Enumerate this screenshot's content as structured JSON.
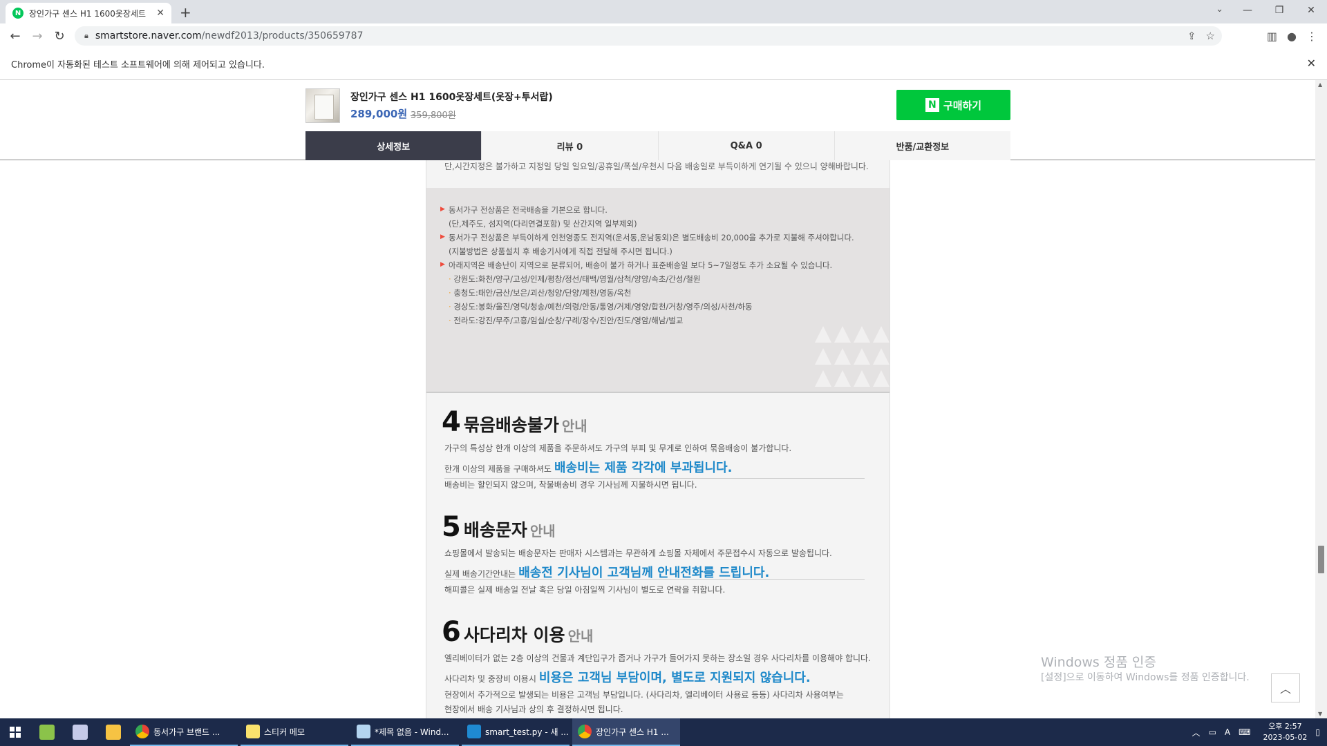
{
  "browser": {
    "tab_title": "장인가구 센스 H1 1600옷장세트",
    "url_host": "smartstore.naver.com",
    "url_path": "/newdf2013/products/350659787",
    "infobar_text": "Chrome이 자동화된 테스트 소프트웨어에 의해 제어되고 있습니다."
  },
  "product": {
    "name": "장인가구 센스 H1 1600옷장세트(옷장+투서랍)",
    "price": "289,000원",
    "original_price": "359,800원",
    "buy_label": "구매하기",
    "buy_logo": "N"
  },
  "tabs": [
    {
      "label": "상세정보"
    },
    {
      "label": "리뷰 0"
    },
    {
      "label": "Q&A 0"
    },
    {
      "label": "반품/교환정보"
    }
  ],
  "detail": {
    "line0": "단,시간지정은 불가하고 지정일 당일  일요일/공휴일/폭설/우천시 다음 배송일로 부득이하게 연기될 수 있으니  양해바랍니다.",
    "box": {
      "b1a": "동서가구 전상품은 전국배송을 기본으로 합니다.",
      "b1b": "(단,제주도, 섬지역(다리연결포함) 및 산간지역 일부제외)",
      "b2a": "동서가구 전상품은 부득이하게 인천영종도 전지역(운서동,운남동외)은 별도배송비 20,000을 추가로 지불해 주셔야합니다.",
      "b2b": "(지불방법은 상품설치 후 배송기사에게 직접 전달해 주시면 됩니다.)",
      "b3a": "아래지역은 배송난이 지역으로 분류되어, 배송이 불가 하거나 표준배송일 보다 5~7일정도 추가 소요될 수 있습니다.",
      "r1": "강원도:화천/양구/고성/인제/평창/정선/태백/영월/삼척/양양/속초/간성/철원",
      "r2": "충청도:태안/금산/보은/괴산/청양/단양/제천/영동/옥천",
      "r3": "경상도:봉화/울진/영덕/청송/예천/의령/안동/통영/거제/영양/합천/거창/영주/의성/사천/하동",
      "r4": "전라도:강진/무주/고흥/임실/순창/구례/장수/진안/진도/영암/해남/벌교"
    },
    "s4": {
      "num": "4",
      "title": "묶음배송불가",
      "suffix": "안내",
      "l1": "가구의 특성상 한개 이상의 제품을 주문하셔도 가구의 부피 및 무게로 인하여 묶음배송이 불가합니다.",
      "l2": "한개 이상의 제품을 구매하셔도",
      "l2h": "배송비는 제품 각각에 부과됩니다.",
      "l3": "배송비는 할인되지 않으며, 착불배송비 경우 기사님께 지불하시면 됩니다."
    },
    "s5": {
      "num": "5",
      "title": "배송문자",
      "suffix": "안내",
      "l1": "쇼핑몰에서 발송되는 배송문자는 판매자 시스템과는 무관하게 쇼핑몰 자체에서 주문접수시 자동으로 발송됩니다.",
      "l2": "실제 배송기간안내는",
      "l2h": "배송전 기사님이 고객님께 안내전화를 드립니다.",
      "l3": "해피콜은 실제 배송일 전날 혹은 당일 아침일찍 기사님이 별도로 연락을 취합니다."
    },
    "s6": {
      "num": "6",
      "title": "사다리차 이용",
      "suffix": "안내",
      "l1": "엘리베이터가 없는 2층 이상의 건물과 계단입구가 좁거나 가구가 들어가지 못하는 장소일 경우 사다리차를 이용해야 합니다.",
      "l2": "사다리차 및 중장비 이용시",
      "l2h": "비용은 고객님 부담이며, 별도로 지원되지 않습니다.",
      "l3": "현장에서 추가적으로 발생되는 비용은 고객님 부담입니다. (사다리차, 엘리베이터 사용료 등등) 사다리차 사용여부는",
      "l4": "현장에서 배송 기사님과 상의 후 결정하시면 됩니다."
    }
  },
  "watermark": {
    "line1": "Windows 정품 인증",
    "line2": "[설정]으로 이동하여 Windows를 정품 인증합니다."
  },
  "taskbar": {
    "apps": [
      {
        "label": "동서가구 브랜드 ..."
      },
      {
        "label": "스티커 메모"
      },
      {
        "label": "*제목 없음 - Wind..."
      },
      {
        "label": "smart_test.py - 새 ..."
      },
      {
        "label": "장인가구 센스 H1 ..."
      }
    ],
    "ime": "A",
    "time": "오후 2:57",
    "date": "2023-05-02"
  }
}
